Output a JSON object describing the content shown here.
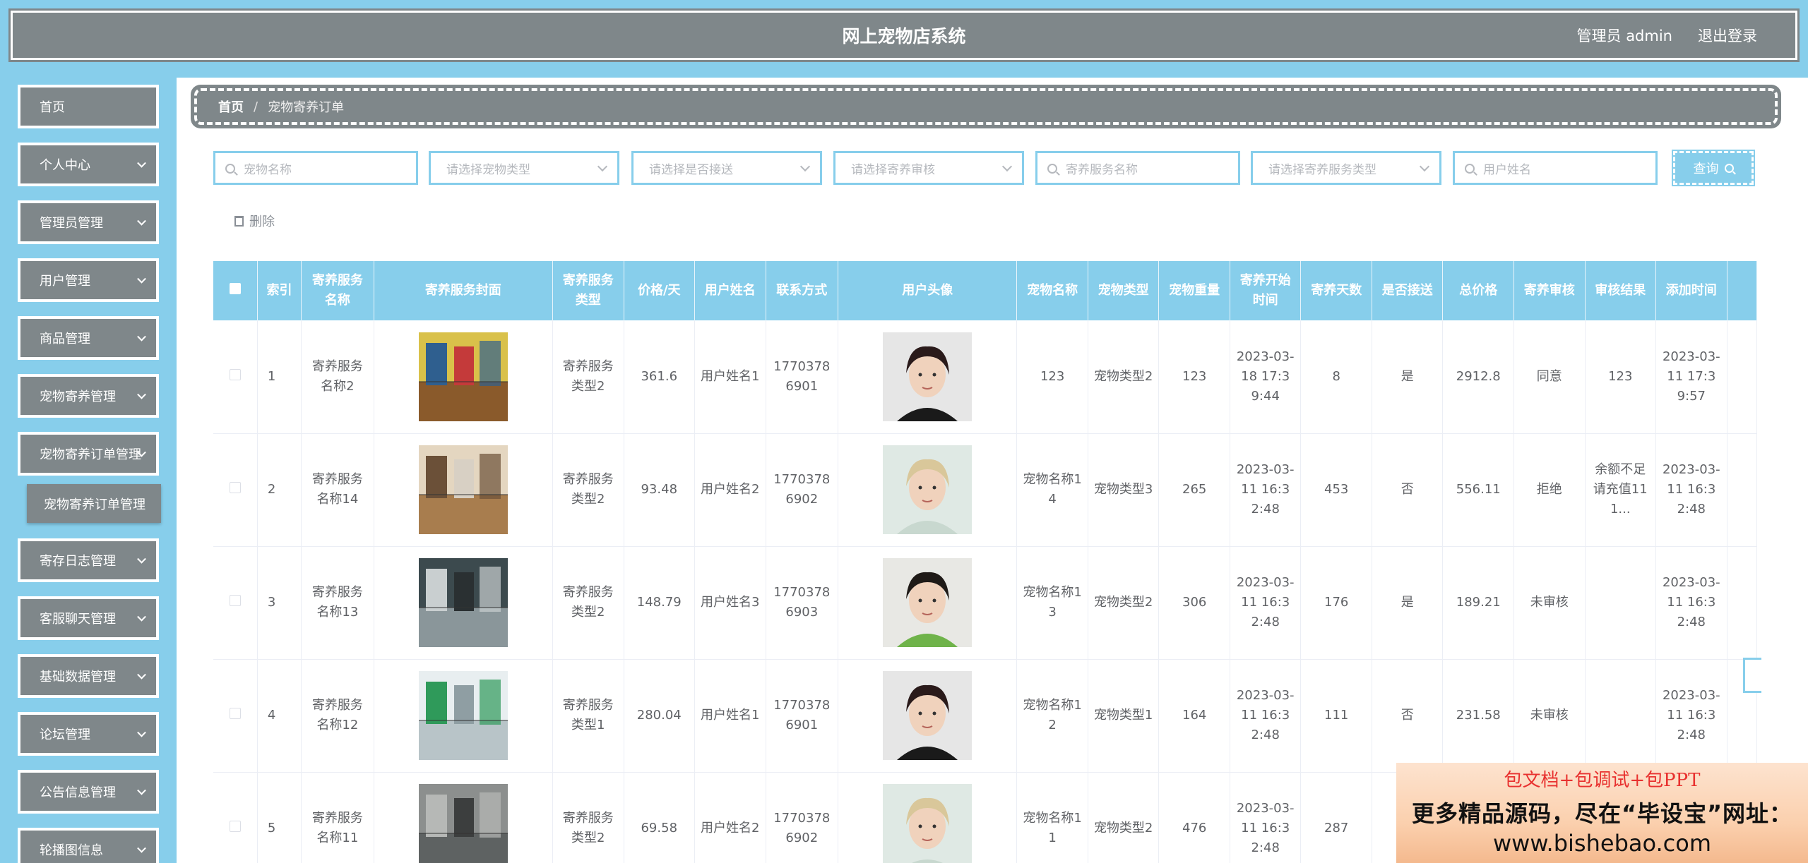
{
  "header": {
    "title": "网上宠物店系统",
    "admin_label": "管理员 admin",
    "logout": "退出登录"
  },
  "sidebar": {
    "items": [
      {
        "label": "首页",
        "has_children": false
      },
      {
        "label": "个人中心",
        "has_children": true
      },
      {
        "label": "管理员管理",
        "has_children": true
      },
      {
        "label": "用户管理",
        "has_children": true
      },
      {
        "label": "商品管理",
        "has_children": true
      },
      {
        "label": "宠物寄养管理",
        "has_children": true
      },
      {
        "label": "宠物寄养订单管理",
        "has_children": true
      },
      {
        "label": "寄存日志管理",
        "has_children": true
      },
      {
        "label": "客服聊天管理",
        "has_children": true
      },
      {
        "label": "基础数据管理",
        "has_children": true
      },
      {
        "label": "论坛管理",
        "has_children": true
      },
      {
        "label": "公告信息管理",
        "has_children": true
      },
      {
        "label": "轮播图信息",
        "has_children": true
      }
    ],
    "active_submenu": "宠物寄养订单管理"
  },
  "breadcrumb": {
    "home": "首页",
    "separator": "/",
    "current": "宠物寄养订单"
  },
  "search": {
    "pet_name": "宠物名称",
    "pet_type": "请选择宠物类型",
    "pickup": "请选择是否接送",
    "audit": "请选择寄养审核",
    "service_name": "寄养服务名称",
    "service_type": "请选择寄养服务类型",
    "user_name": "用户姓名",
    "query_button": "查询"
  },
  "toolbar": {
    "delete_label": "删除"
  },
  "table": {
    "columns": [
      "索引",
      "寄养服务名称",
      "寄养服务封面",
      "寄养服务类型",
      "价格/天",
      "用户姓名",
      "联系方式",
      "用户头像",
      "宠物名称",
      "宠物类型",
      "宠物重量",
      "寄养开始时间",
      "寄养天数",
      "是否接送",
      "总价格",
      "寄养审核",
      "审核结果",
      "添加时间"
    ],
    "rows": [
      {
        "index": "1",
        "service_name": "寄养服务名称2",
        "service_type": "寄养服务类型2",
        "price": "361.6",
        "user_name": "用户姓名1",
        "phone": "17703786901",
        "pet_name": "123",
        "pet_type": "宠物类型2",
        "weight": "123",
        "start_time": "2023-03-18 17:39:44",
        "days": "8",
        "pickup": "是",
        "total": "2912.8",
        "audit": "同意",
        "result": "123",
        "added": "2023-03-11 17:39:57",
        "cover": "cover-a",
        "avatar": "avatar-male"
      },
      {
        "index": "2",
        "service_name": "寄养服务名称14",
        "service_type": "寄养服务类型2",
        "price": "93.48",
        "user_name": "用户姓名2",
        "phone": "17703786902",
        "pet_name": "宠物名称14",
        "pet_type": "宠物类型3",
        "weight": "265",
        "start_time": "2023-03-11 16:32:48",
        "days": "453",
        "pickup": "否",
        "total": "556.11",
        "audit": "拒绝",
        "result": "余额不足请充值111...",
        "added": "2023-03-11 16:32:48",
        "cover": "cover-b",
        "avatar": "avatar-blonde"
      },
      {
        "index": "3",
        "service_name": "寄养服务名称13",
        "service_type": "寄养服务类型2",
        "price": "148.79",
        "user_name": "用户姓名3",
        "phone": "17703786903",
        "pet_name": "宠物名称13",
        "pet_type": "宠物类型2",
        "weight": "306",
        "start_time": "2023-03-11 16:32:48",
        "days": "176",
        "pickup": "是",
        "total": "189.21",
        "audit": "未审核",
        "result": "",
        "added": "2023-03-11 16:32:48",
        "cover": "cover-c",
        "avatar": "avatar-girl"
      },
      {
        "index": "4",
        "service_name": "寄养服务名称12",
        "service_type": "寄养服务类型1",
        "price": "280.04",
        "user_name": "用户姓名1",
        "phone": "17703786901",
        "pet_name": "宠物名称12",
        "pet_type": "宠物类型1",
        "weight": "164",
        "start_time": "2023-03-11 16:32:48",
        "days": "111",
        "pickup": "否",
        "total": "231.58",
        "audit": "未审核",
        "result": "",
        "added": "2023-03-11 16:32:48",
        "cover": "cover-d",
        "avatar": "avatar-male"
      },
      {
        "index": "5",
        "service_name": "寄养服务名称11",
        "service_type": "寄养服务类型2",
        "price": "69.58",
        "user_name": "用户姓名2",
        "phone": "17703786902",
        "pet_name": "宠物名称11",
        "pet_type": "宠物类型2",
        "weight": "476",
        "start_time": "2023-03-11 16:32:48",
        "days": "287",
        "pickup": "",
        "total": "",
        "audit": "",
        "result": "",
        "added": "",
        "cover": "cover-e",
        "avatar": "avatar-blonde"
      }
    ]
  },
  "promo": {
    "line1": "包文档+包调试+包PPT",
    "line2": "更多精品源码，尽在“毕设宝”网址：",
    "line3": "www.bishebao.com"
  },
  "colors": {
    "accent": "#87ceeb",
    "panel": "#7f878a",
    "promo_red": "#e8312f"
  }
}
